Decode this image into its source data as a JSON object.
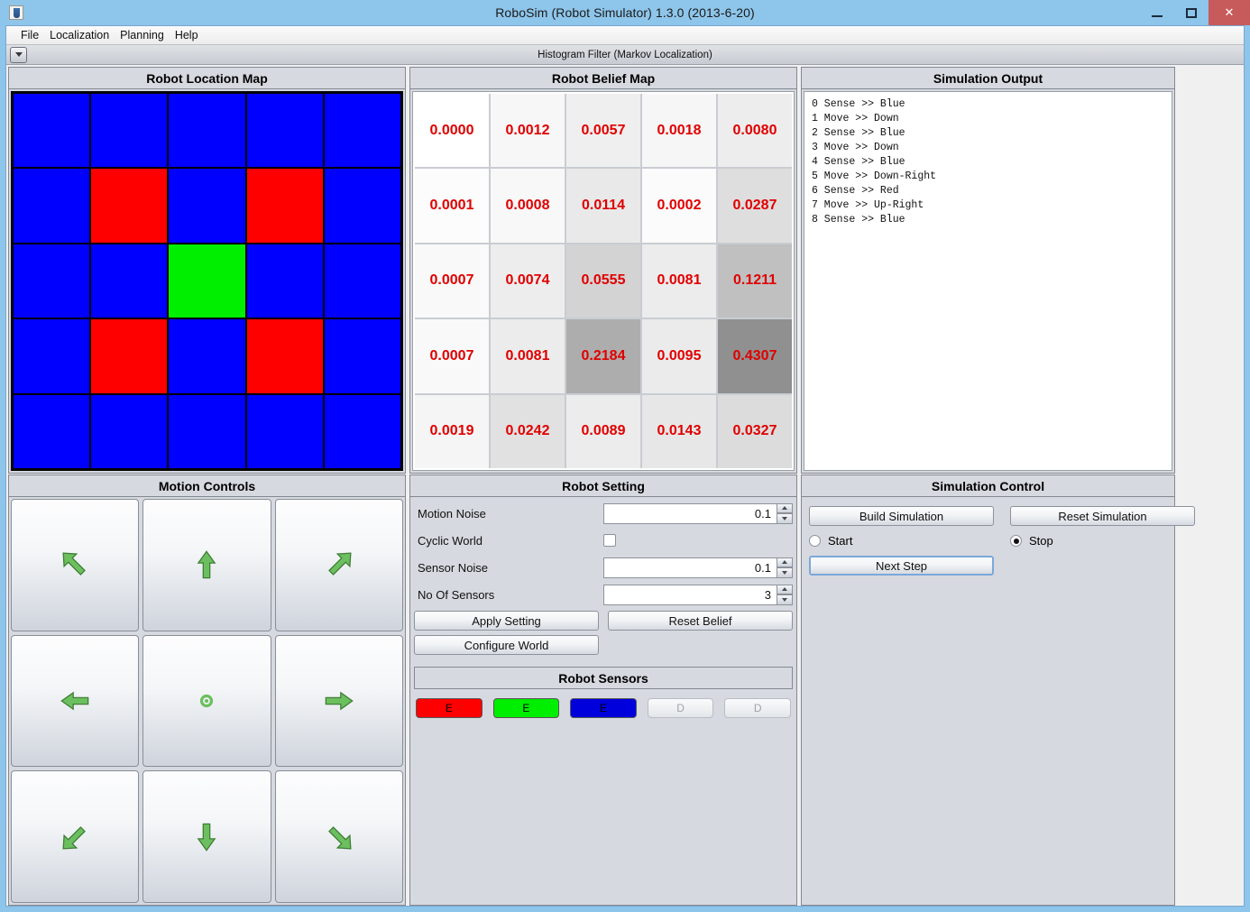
{
  "window": {
    "title": "RoboSim (Robot Simulator)  1.3.0 (2013-6-20)",
    "minimize_label": "",
    "maximize_label": "",
    "close_label": "✕"
  },
  "menubar": {
    "items": [
      {
        "label": "File"
      },
      {
        "label": "Localization"
      },
      {
        "label": "Planning"
      },
      {
        "label": "Help"
      }
    ]
  },
  "toolbar": {
    "title": "Histogram Filter (Markov Localization)",
    "dropdown_icon": "chevron-down-icon"
  },
  "panels": {
    "location_map": {
      "title": "Robot Location Map"
    },
    "belief_map": {
      "title": "Robot Belief Map"
    },
    "simulation_output": {
      "title": "Simulation Output"
    },
    "motion_controls": {
      "title": "Motion Controls"
    },
    "robot_setting": {
      "title": "Robot Setting"
    },
    "simulation_control": {
      "title": "Simulation Control"
    },
    "robot_sensors": {
      "title": "Robot Sensors"
    }
  },
  "location_map": {
    "rows": 5,
    "cols": 5,
    "colors": {
      "blue": "#0000ff",
      "red": "#ff0000",
      "green": "#00ee00"
    },
    "cells": [
      [
        "blue",
        "blue",
        "blue",
        "blue",
        "blue"
      ],
      [
        "blue",
        "red",
        "blue",
        "red",
        "blue"
      ],
      [
        "blue",
        "blue",
        "green",
        "blue",
        "blue"
      ],
      [
        "blue",
        "red",
        "blue",
        "red",
        "blue"
      ],
      [
        "blue",
        "blue",
        "blue",
        "blue",
        "blue"
      ]
    ]
  },
  "chart_data": {
    "type": "heatmap",
    "title": "Robot Belief Map",
    "rows": 5,
    "cols": 5,
    "values": [
      [
        0.0,
        0.0012,
        0.0057,
        0.0018,
        0.008
      ],
      [
        0.0001,
        0.0008,
        0.0114,
        0.0002,
        0.0287
      ],
      [
        0.0007,
        0.0074,
        0.0555,
        0.0081,
        0.1211
      ],
      [
        0.0007,
        0.0081,
        0.2184,
        0.0095,
        0.4307
      ],
      [
        0.0019,
        0.0242,
        0.0089,
        0.0143,
        0.0327
      ]
    ],
    "labels": [
      [
        "0.0000",
        "0.0012",
        "0.0057",
        "0.0018",
        "0.0080"
      ],
      [
        "0.0001",
        "0.0008",
        "0.0114",
        "0.0002",
        "0.0287"
      ],
      [
        "0.0007",
        "0.0074",
        "0.0555",
        "0.0081",
        "0.1211"
      ],
      [
        "0.0007",
        "0.0081",
        "0.2184",
        "0.0095",
        "0.4307"
      ],
      [
        "0.0019",
        "0.0242",
        "0.0089",
        "0.0143",
        "0.0327"
      ]
    ],
    "text_color": "#e00000",
    "cell_min_color": "#ffffff",
    "cell_max_color": "#909090",
    "zlim": [
      0,
      0.4307
    ],
    "grid": true,
    "legend": "none"
  },
  "simulation_output": {
    "lines": [
      "0 Sense >> Blue",
      "1 Move  >> Down",
      "2 Sense >> Blue",
      "3 Move  >> Down",
      "4 Sense >> Blue",
      "5 Move  >> Down-Right",
      "6 Sense >> Red",
      "7 Move  >> Up-Right",
      "8 Sense >> Blue"
    ]
  },
  "motion_controls": {
    "buttons": [
      {
        "name": "move-up-left-button",
        "icon": "arrow-up-left-icon"
      },
      {
        "name": "move-up-button",
        "icon": "arrow-up-icon"
      },
      {
        "name": "move-up-right-button",
        "icon": "arrow-up-right-icon"
      },
      {
        "name": "move-left-button",
        "icon": "arrow-left-icon"
      },
      {
        "name": "move-stay-button",
        "icon": "dot-icon"
      },
      {
        "name": "move-right-button",
        "icon": "arrow-right-icon"
      },
      {
        "name": "move-down-left-button",
        "icon": "arrow-down-left-icon"
      },
      {
        "name": "move-down-button",
        "icon": "arrow-down-icon"
      },
      {
        "name": "move-down-right-button",
        "icon": "arrow-down-right-icon"
      }
    ],
    "arrow_color": "#6cbf5e"
  },
  "robot_setting": {
    "motion_noise": {
      "label": "Motion Noise",
      "value": "0.1"
    },
    "cyclic_world": {
      "label": "Cyclic World",
      "checked": false
    },
    "sensor_noise": {
      "label": "Sensor Noise",
      "value": "0.1"
    },
    "no_of_sensors": {
      "label": "No Of Sensors",
      "value": "3"
    },
    "apply_setting_label": "Apply Setting",
    "reset_belief_label": "Reset Belief",
    "configure_world_label": "Configure World"
  },
  "robot_sensors": {
    "items": [
      {
        "label": "E",
        "color": "#ff0000",
        "enabled": true
      },
      {
        "label": "E",
        "color": "#00ee00",
        "enabled": true
      },
      {
        "label": "E",
        "color": "#0000dd",
        "enabled": true
      },
      {
        "label": "D",
        "color": "",
        "enabled": false
      },
      {
        "label": "D",
        "color": "",
        "enabled": false
      }
    ]
  },
  "simulation_control": {
    "build_label": "Build Simulation",
    "reset_label": "Reset Simulation",
    "start_label": "Start",
    "stop_label": "Stop",
    "selected": "Stop",
    "next_step_label": "Next Step"
  }
}
